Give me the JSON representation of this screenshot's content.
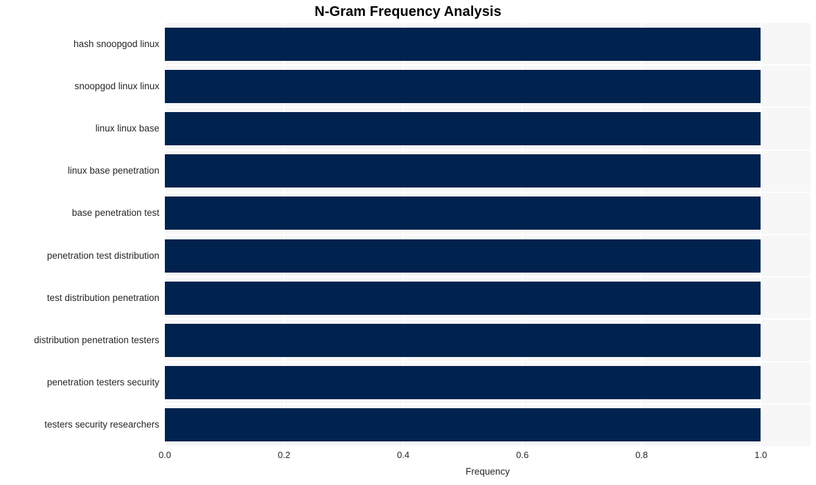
{
  "chart_data": {
    "type": "bar",
    "orientation": "horizontal",
    "title": "N-Gram Frequency Analysis",
    "xlabel": "Frequency",
    "ylabel": "",
    "categories": [
      "hash snoopgod linux",
      "snoopgod linux linux",
      "linux linux base",
      "linux base penetration",
      "base penetration test",
      "penetration test distribution",
      "test distribution penetration",
      "distribution penetration testers",
      "penetration testers security",
      "testers security researchers"
    ],
    "values": [
      1.0,
      1.0,
      1.0,
      1.0,
      1.0,
      1.0,
      1.0,
      1.0,
      1.0,
      1.0
    ],
    "xlim": [
      0.0,
      1.0833
    ],
    "xticks": [
      0.0,
      0.2,
      0.4,
      0.6,
      0.8,
      1.0
    ],
    "xtick_labels": [
      "0.0",
      "0.2",
      "0.4",
      "0.6",
      "0.8",
      "1.0"
    ],
    "grid": true,
    "grid_color": "#ffffff",
    "legend": null,
    "bar_color": "#00224e",
    "plot_background": "#f7f7f7",
    "figure_background": "#ffffff",
    "title_color": "#000000",
    "tick_label_color": "#262626"
  }
}
